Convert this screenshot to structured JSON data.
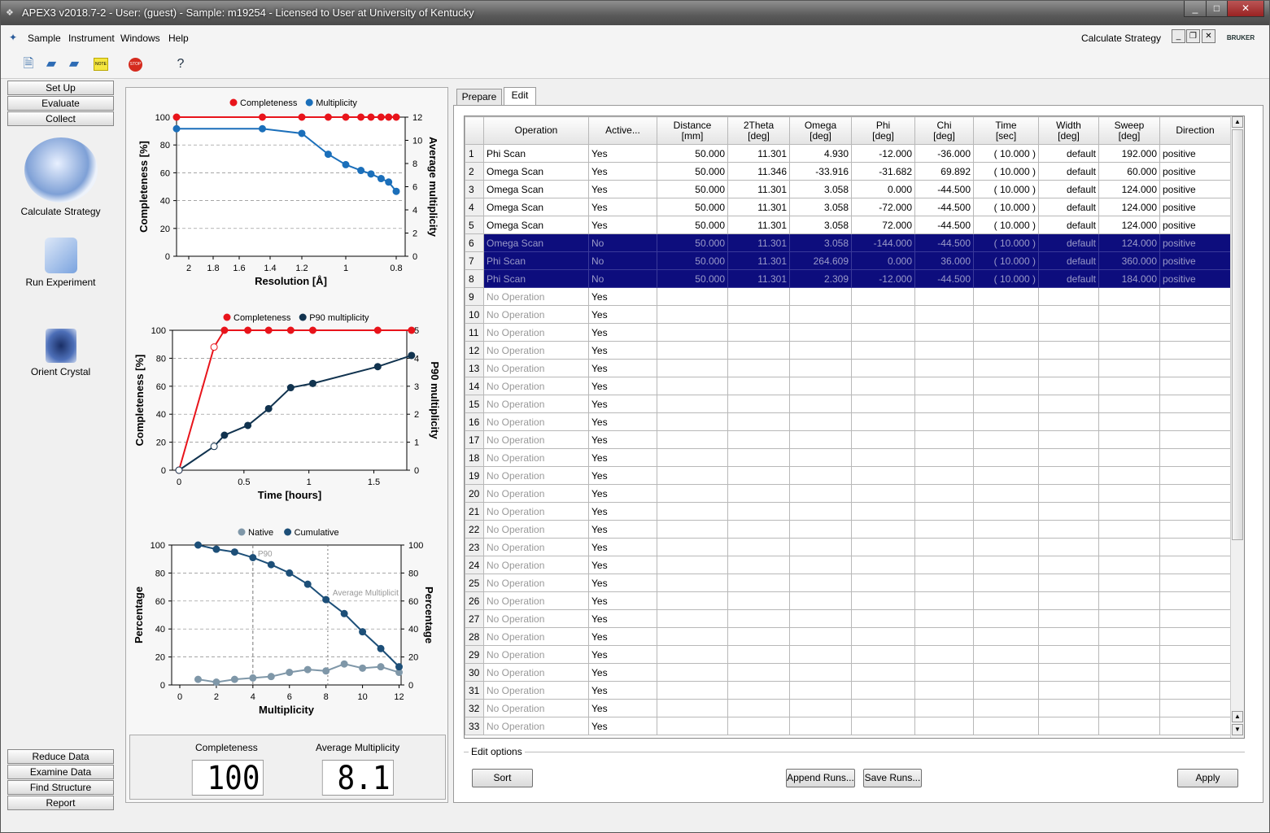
{
  "window": {
    "title": "APEX3 v2018.7-2 - User: (guest) - Sample: m19254 - Licensed to User at University of Kentucky",
    "minimize": "_",
    "maximize": "□",
    "close": "✕"
  },
  "menu": {
    "items": [
      "Sample",
      "Instrument",
      "Windows",
      "Help"
    ],
    "current_tool": "Calculate Strategy",
    "brand": "BRUKER"
  },
  "toolbar": {
    "icons": [
      "new-document-icon",
      "open-folder-icon",
      "open-files-icon",
      "note-icon",
      "stop-icon",
      "help-pointer-icon"
    ],
    "note_text": "NOTE",
    "stop_text": "STOP"
  },
  "nav": {
    "top_buttons": [
      "Set Up",
      "Evaluate",
      "Collect"
    ],
    "tools": [
      "Calculate Strategy",
      "Run Experiment",
      "Orient Crystal"
    ],
    "bottom_buttons": [
      "Reduce Data",
      "Examine Data",
      "Find Structure",
      "Report"
    ]
  },
  "chart_data": [
    {
      "type": "line",
      "legend": [
        "Completeness",
        "Multiplicity"
      ],
      "xlabel": "Resolution [Å]",
      "ylabel": "Completeness [%]",
      "y2label": "Average multiplicity",
      "xticks": [
        "2",
        "1.8",
        "1.6",
        "1.4",
        "1.2",
        "1",
        "0.8"
      ],
      "yticks": [
        "100",
        "80",
        "60",
        "40",
        "20",
        "0"
      ],
      "y2ticks": [
        "12",
        "10",
        "8",
        "6",
        "4",
        "2",
        "0"
      ],
      "ylim": [
        0,
        100
      ],
      "y2lim": [
        0,
        12
      ],
      "series": [
        {
          "name": "Completeness",
          "color": "#e8141b",
          "x": [
            2.1,
            1.45,
            1.2,
            1.08,
            1.0,
            0.94,
            0.9,
            0.86,
            0.83,
            0.8
          ],
          "y": [
            100,
            100,
            100,
            100,
            100,
            100,
            100,
            100,
            100,
            100
          ]
        },
        {
          "name": "Multiplicity",
          "color": "#1b6fba",
          "x": [
            2.1,
            1.45,
            1.2,
            1.08,
            1.0,
            0.94,
            0.9,
            0.86,
            0.83,
            0.8
          ],
          "y": [
            11.0,
            11.0,
            10.6,
            8.8,
            7.9,
            7.4,
            7.1,
            6.7,
            6.4,
            5.6
          ]
        }
      ]
    },
    {
      "type": "line",
      "legend": [
        "Completeness",
        "P90 multiplicity"
      ],
      "xlabel": "Time [hours]",
      "ylabel": "Completeness [%]",
      "y2label": "P90 multiplicity",
      "xticks": [
        "0",
        "0.5",
        "1",
        "1.5"
      ],
      "yticks": [
        "100",
        "80",
        "60",
        "40",
        "20",
        "0"
      ],
      "y2ticks": [
        "5",
        "4",
        "3",
        "2",
        "1",
        "0"
      ],
      "xlim": [
        0,
        1.8
      ],
      "ylim": [
        0,
        100
      ],
      "y2lim": [
        0,
        5
      ],
      "series": [
        {
          "name": "Completeness",
          "color": "#e8141b",
          "x": [
            0,
            0.27,
            0.35,
            0.53,
            0.69,
            0.86,
            1.03,
            1.53,
            1.79
          ],
          "y": [
            0,
            88,
            100,
            100,
            100,
            100,
            100,
            100,
            100
          ]
        },
        {
          "name": "P90 multiplicity",
          "color": "#11334f",
          "x": [
            0,
            0.27,
            0.35,
            0.53,
            0.69,
            0.86,
            1.03,
            1.53,
            1.79
          ],
          "y": [
            0,
            0.85,
            1.25,
            1.6,
            2.2,
            2.95,
            3.1,
            3.7,
            4.1
          ]
        }
      ]
    },
    {
      "type": "line",
      "legend": [
        "Native",
        "Cumulative"
      ],
      "xlabel": "Multiplicity",
      "ylabel": "Percentage",
      "y2label": "Percentage",
      "annotations": [
        "P90",
        "Average Multiplicit"
      ],
      "xticks": [
        "0",
        "2",
        "4",
        "6",
        "8",
        "10",
        "12"
      ],
      "yticks": [
        "100",
        "80",
        "60",
        "40",
        "20",
        "0"
      ],
      "y2ticks": [
        "100",
        "80",
        "60",
        "40",
        "20",
        "0"
      ],
      "xlim": [
        0,
        12.2
      ],
      "ylim": [
        0,
        100
      ],
      "series": [
        {
          "name": "Native",
          "color": "#7f97a8",
          "x": [
            1,
            2,
            3,
            4,
            5,
            6,
            7,
            8,
            9,
            10,
            11,
            12
          ],
          "y": [
            4,
            2,
            4,
            5,
            6,
            9,
            11,
            10,
            15,
            12,
            13,
            9
          ]
        },
        {
          "name": "Cumulative",
          "color": "#1d4f78",
          "x": [
            1,
            2,
            3,
            4,
            5,
            6,
            7,
            8,
            9,
            10,
            11,
            12
          ],
          "y": [
            100,
            97,
            95,
            91,
            86,
            80,
            72,
            61,
            51,
            38,
            26,
            13
          ]
        }
      ]
    }
  ],
  "summary": {
    "completeness_label": "Completeness",
    "completeness_value": "100",
    "multiplicity_label": "Average Multiplicity",
    "multiplicity_value": "8.1"
  },
  "tabs": [
    "Prepare",
    "Edit"
  ],
  "active_tab": "Edit",
  "table": {
    "columns": [
      "",
      "Operation",
      "Active...",
      "Distance\n[mm]",
      "2Theta\n[deg]",
      "Omega\n[deg]",
      "Phi\n[deg]",
      "Chi\n[deg]",
      "Time\n[sec]",
      "Width\n[deg]",
      "Sweep\n[deg]",
      "Direction"
    ],
    "rows": [
      [
        "1",
        "Phi Scan",
        "Yes",
        "50.000",
        "11.301",
        "4.930",
        "-12.000",
        "-36.000",
        "( 10.000 )",
        "default",
        "192.000",
        "positive"
      ],
      [
        "2",
        "Omega Scan",
        "Yes",
        "50.000",
        "11.346",
        "-33.916",
        "-31.682",
        "69.892",
        "( 10.000 )",
        "default",
        "60.000",
        "positive"
      ],
      [
        "3",
        "Omega Scan",
        "Yes",
        "50.000",
        "11.301",
        "3.058",
        "0.000",
        "-44.500",
        "( 10.000 )",
        "default",
        "124.000",
        "positive"
      ],
      [
        "4",
        "Omega Scan",
        "Yes",
        "50.000",
        "11.301",
        "3.058",
        "-72.000",
        "-44.500",
        "( 10.000 )",
        "default",
        "124.000",
        "positive"
      ],
      [
        "5",
        "Omega Scan",
        "Yes",
        "50.000",
        "11.301",
        "3.058",
        "72.000",
        "-44.500",
        "( 10.000 )",
        "default",
        "124.000",
        "positive"
      ],
      [
        "6",
        "Omega Scan",
        "No",
        "50.000",
        "11.301",
        "3.058",
        "-144.000",
        "-44.500",
        "( 10.000 )",
        "default",
        "124.000",
        "positive"
      ],
      [
        "7",
        "Phi Scan",
        "No",
        "50.000",
        "11.301",
        "264.609",
        "0.000",
        "36.000",
        "( 10.000 )",
        "default",
        "360.000",
        "positive"
      ],
      [
        "8",
        "Phi Scan",
        "No",
        "50.000",
        "11.301",
        "2.309",
        "-12.000",
        "-44.500",
        "( 10.000 )",
        "default",
        "184.000",
        "positive"
      ]
    ],
    "selected_rows": [
      6,
      7,
      8
    ],
    "empty_row_start": 9,
    "empty_row_end": 33,
    "empty_operation": "No Operation",
    "empty_active": "Yes"
  },
  "edit_options": {
    "legend": "Edit options",
    "sort": "Sort",
    "append": "Append Runs...",
    "save": "Save Runs...",
    "apply": "Apply"
  }
}
